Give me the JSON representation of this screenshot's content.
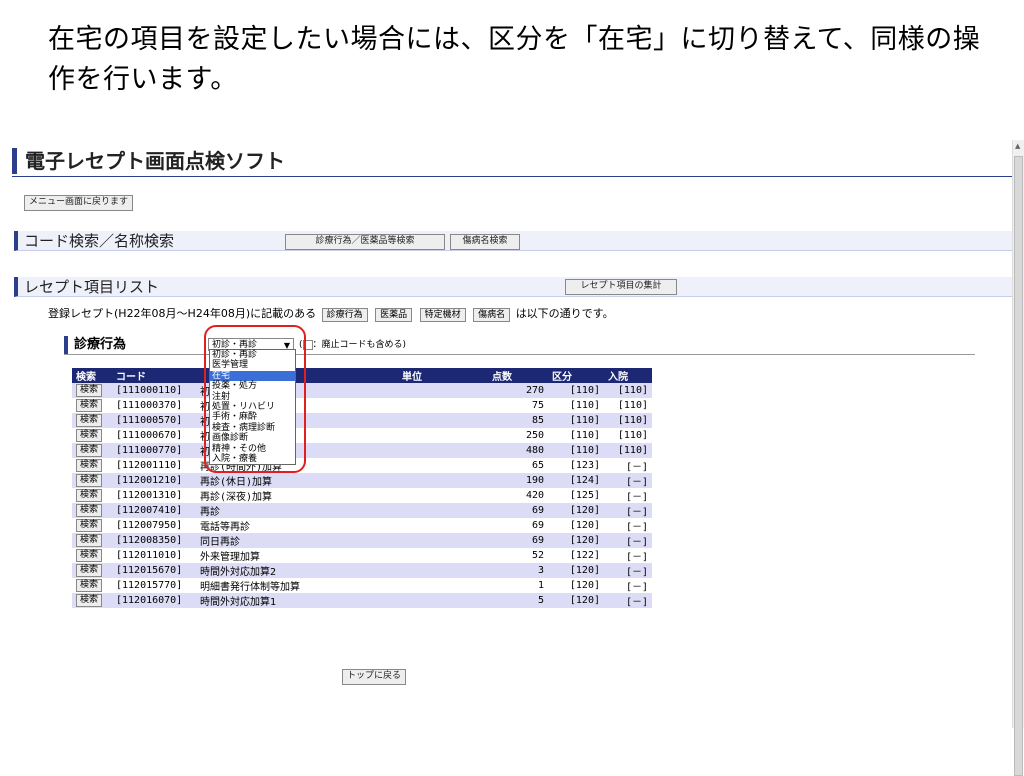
{
  "caption": "在宅の項目を設定したい場合には、区分を「在宅」に切り替えて、同様の操作を行います。",
  "app": {
    "title": "電子レセプト画面点検ソフト",
    "menu_back_button": "メニュー画面に戻ります",
    "code_search": {
      "title": "コード検索／名称検索",
      "buttons": [
        "診療行為／医薬品等検索",
        "傷病名検索"
      ]
    },
    "receipt_list": {
      "title": "レセプト項目リスト",
      "summary_button": "レセプト項目の集計",
      "note_prefix": "登録レセプト(H22年08月～H24年08月)に記載のある",
      "note_buttons": [
        "診療行為",
        "医薬品",
        "特定機材",
        "傷病名"
      ],
      "note_suffix": "は以下の通りです。"
    },
    "procedures": {
      "title": "診療行為",
      "category_selected": "初診・再診",
      "category_options": [
        "初診・再診",
        "医学管理",
        "在宅",
        "投薬・処方",
        "注射",
        "処置・リハビリ",
        "手術・麻酔",
        "検査・病理診断",
        "画像診断",
        "精神・その他",
        "入院・療養"
      ],
      "category_highlighted": "在宅",
      "include_abolished_label": "：廃止コードも含める)",
      "columns": {
        "search": "検索",
        "code": "コード",
        "unit": "単位",
        "points": "点数",
        "division": "区分",
        "inpatient": "入院"
      },
      "search_label": "検索",
      "rows": [
        {
          "code": "[111000110]",
          "name": "初診料",
          "unit": "",
          "points": "270",
          "division": "[110]",
          "inpatient": "[110]"
        },
        {
          "code": "[111000370]",
          "name": "初診料",
          "unit": "",
          "points": "75",
          "division": "[110]",
          "inpatient": "[110]"
        },
        {
          "code": "[111000570]",
          "name": "初診料",
          "unit": "",
          "points": "85",
          "division": "[110]",
          "inpatient": "[110]"
        },
        {
          "code": "[111000670]",
          "name": "初診料",
          "unit": "",
          "points": "250",
          "division": "[110]",
          "inpatient": "[110]"
        },
        {
          "code": "[111000770]",
          "name": "初診料",
          "unit": "",
          "points": "480",
          "division": "[110]",
          "inpatient": "[110]"
        },
        {
          "code": "[112001110]",
          "name": "再診(時間外)加算",
          "unit": "",
          "points": "65",
          "division": "[123]",
          "inpatient": "[－]"
        },
        {
          "code": "[112001210]",
          "name": "再診(休日)加算",
          "unit": "",
          "points": "190",
          "division": "[124]",
          "inpatient": "[－]"
        },
        {
          "code": "[112001310]",
          "name": "再診(深夜)加算",
          "unit": "",
          "points": "420",
          "division": "[125]",
          "inpatient": "[－]"
        },
        {
          "code": "[112007410]",
          "name": "再診",
          "unit": "",
          "points": "69",
          "division": "[120]",
          "inpatient": "[－]"
        },
        {
          "code": "[112007950]",
          "name": "電話等再診",
          "unit": "",
          "points": "69",
          "division": "[120]",
          "inpatient": "[－]"
        },
        {
          "code": "[112008350]",
          "name": "同日再診",
          "unit": "",
          "points": "69",
          "division": "[120]",
          "inpatient": "[－]"
        },
        {
          "code": "[112011010]",
          "name": "外来管理加算",
          "unit": "",
          "points": "52",
          "division": "[122]",
          "inpatient": "[－]"
        },
        {
          "code": "[112015670]",
          "name": "時間外対応加算2",
          "unit": "",
          "points": "3",
          "division": "[120]",
          "inpatient": "[－]"
        },
        {
          "code": "[112015770]",
          "name": "明細書発行体制等加算",
          "unit": "",
          "points": "1",
          "division": "[120]",
          "inpatient": "[－]"
        },
        {
          "code": "[112016070]",
          "name": "時間外対応加算1",
          "unit": "",
          "points": "5",
          "division": "[120]",
          "inpatient": "[－]"
        }
      ]
    },
    "back_to_top_button": "トップに戻る"
  },
  "colors": {
    "accent": "#2c3e8c",
    "table_header": "#1c2874",
    "row_alt": "#dcdcf6",
    "highlight": "#e02020",
    "selected": "#3a6fd8"
  }
}
